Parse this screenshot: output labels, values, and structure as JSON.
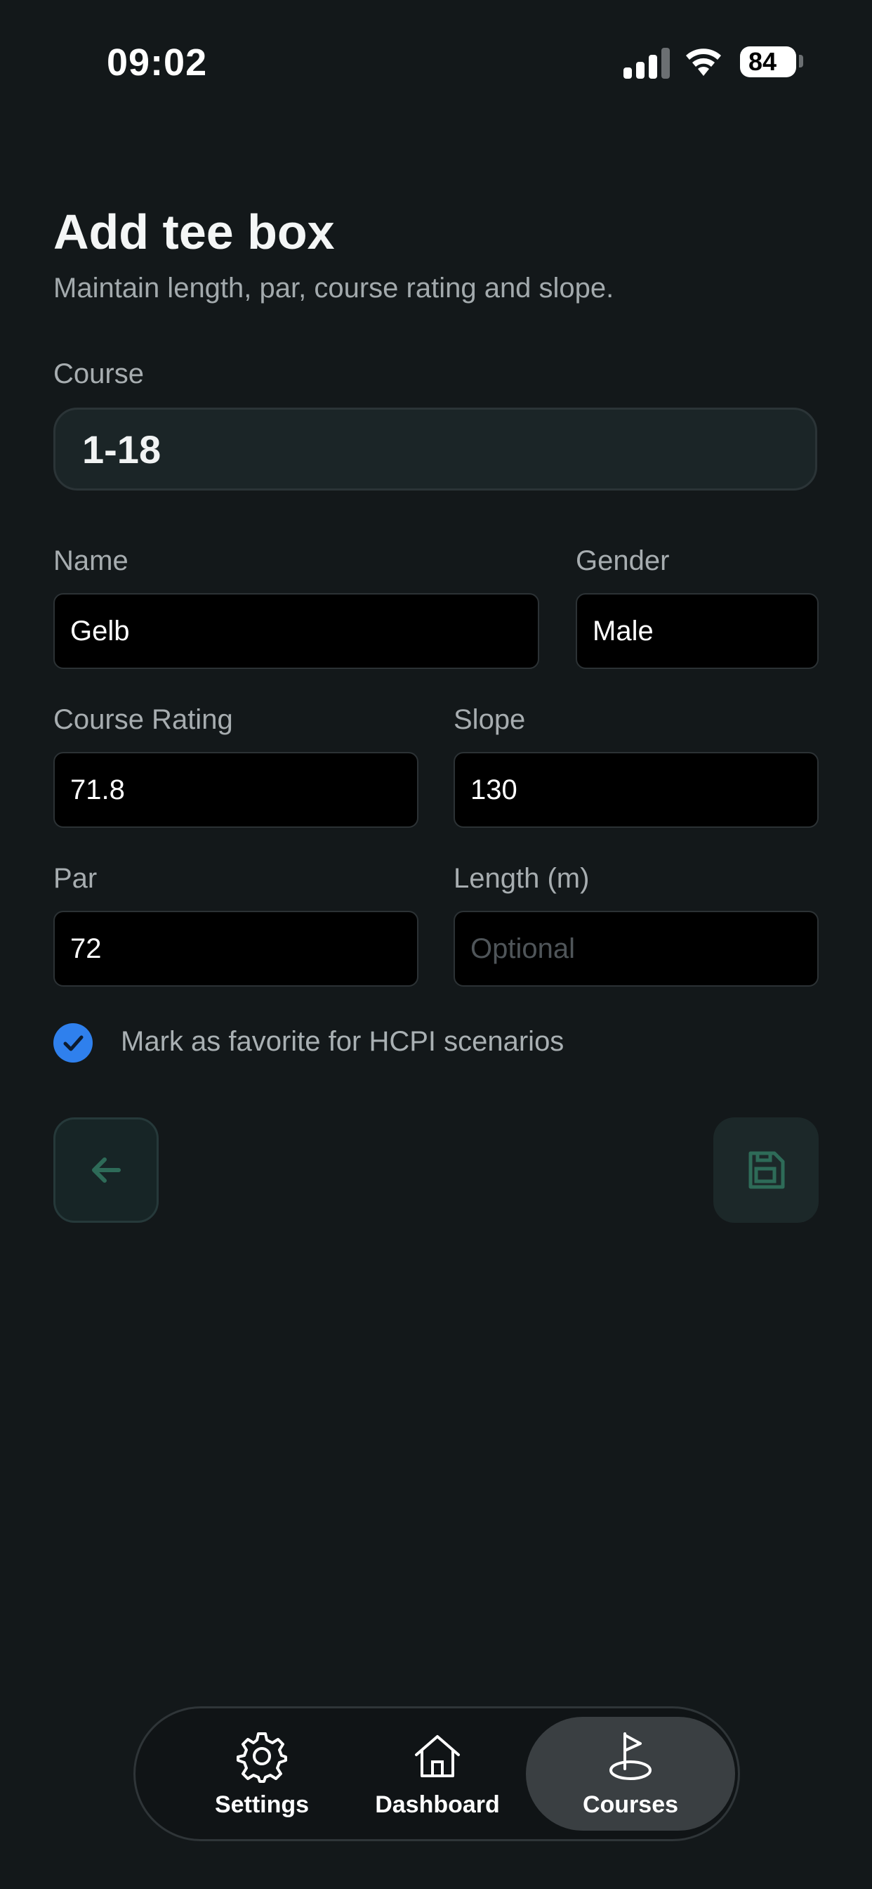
{
  "status_bar": {
    "time": "09:02",
    "battery": "84"
  },
  "header": {
    "title": "Add tee box",
    "subtitle": "Maintain length, par, course rating and slope."
  },
  "form": {
    "course_label": "Course",
    "course_value": "1-18",
    "name_label": "Name",
    "name_value": "Gelb",
    "gender_label": "Gender",
    "gender_value": "Male",
    "rating_label": "Course Rating",
    "rating_value": "71.8",
    "slope_label": "Slope",
    "slope_value": "130",
    "par_label": "Par",
    "par_value": "72",
    "length_label": "Length (m)",
    "length_placeholder": "Optional",
    "favorite_label": "Mark as favorite for HCPI scenarios",
    "favorite_checked": true
  },
  "actions": {
    "back_icon": "arrow-left-icon",
    "save_icon": "floppy-disk-icon"
  },
  "tab_bar": {
    "tabs": [
      {
        "label": "Settings",
        "icon": "gear-icon"
      },
      {
        "label": "Dashboard",
        "icon": "home-icon"
      },
      {
        "label": "Courses",
        "icon": "flag-icon",
        "active": true
      }
    ]
  },
  "colors": {
    "background": "#13181a",
    "accent": "#2f80ed",
    "action_green": "#2e6b58"
  }
}
